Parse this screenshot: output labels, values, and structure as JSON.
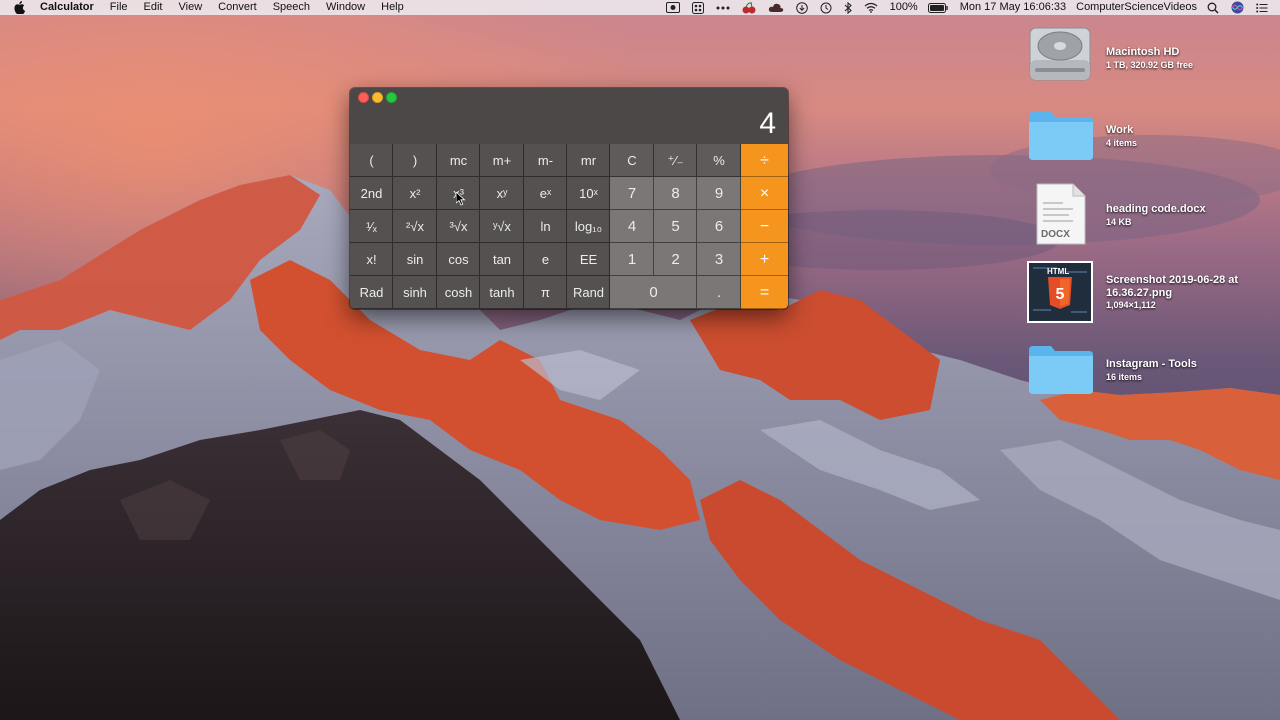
{
  "menubar": {
    "app_name": "Calculator",
    "menus": [
      "File",
      "Edit",
      "View",
      "Convert",
      "Speech",
      "Window",
      "Help"
    ],
    "battery": "100%",
    "datetime": "Mon 17 May  16:06:33",
    "user": "ComputerScienceVideos"
  },
  "calculator": {
    "display": "4",
    "keys": [
      {
        "label": "(",
        "kind": "sci"
      },
      {
        "label": ")",
        "kind": "sci"
      },
      {
        "label": "mc",
        "kind": "sci"
      },
      {
        "label": "m+",
        "kind": "sci"
      },
      {
        "label": "m-",
        "kind": "sci"
      },
      {
        "label": "mr",
        "kind": "sci"
      },
      {
        "label": "C",
        "kind": "top"
      },
      {
        "label": "⁺∕₋",
        "kind": "top"
      },
      {
        "label": "%",
        "kind": "top"
      },
      {
        "label": "÷",
        "kind": "op"
      },
      {
        "label": "2nd",
        "kind": "sci"
      },
      {
        "label": "x²",
        "kind": "sci"
      },
      {
        "label": "x³",
        "kind": "sci"
      },
      {
        "label": "xʸ",
        "kind": "sci"
      },
      {
        "label": "eˣ",
        "kind": "sci"
      },
      {
        "label": "10ˣ",
        "kind": "sci"
      },
      {
        "label": "7",
        "kind": "num"
      },
      {
        "label": "8",
        "kind": "num"
      },
      {
        "label": "9",
        "kind": "num"
      },
      {
        "label": "×",
        "kind": "op"
      },
      {
        "label": "¹∕ₓ",
        "kind": "sci"
      },
      {
        "label": "²√x",
        "kind": "sci"
      },
      {
        "label": "³√x",
        "kind": "sci"
      },
      {
        "label": "ʸ√x",
        "kind": "sci"
      },
      {
        "label": "ln",
        "kind": "sci"
      },
      {
        "label": "log₁₀",
        "kind": "sci"
      },
      {
        "label": "4",
        "kind": "num"
      },
      {
        "label": "5",
        "kind": "num"
      },
      {
        "label": "6",
        "kind": "num"
      },
      {
        "label": "−",
        "kind": "op"
      },
      {
        "label": "x!",
        "kind": "sci"
      },
      {
        "label": "sin",
        "kind": "sci"
      },
      {
        "label": "cos",
        "kind": "sci"
      },
      {
        "label": "tan",
        "kind": "sci"
      },
      {
        "label": "e",
        "kind": "sci"
      },
      {
        "label": "EE",
        "kind": "sci"
      },
      {
        "label": "1",
        "kind": "num"
      },
      {
        "label": "2",
        "kind": "num"
      },
      {
        "label": "3",
        "kind": "num"
      },
      {
        "label": "+",
        "kind": "op"
      },
      {
        "label": "Rad",
        "kind": "sci"
      },
      {
        "label": "sinh",
        "kind": "sci"
      },
      {
        "label": "cosh",
        "kind": "sci"
      },
      {
        "label": "tanh",
        "kind": "sci"
      },
      {
        "label": "π",
        "kind": "sci"
      },
      {
        "label": "Rand",
        "kind": "sci"
      },
      {
        "label": "0",
        "kind": "num zero"
      },
      {
        "label": ".",
        "kind": "num"
      },
      {
        "label": "=",
        "kind": "op"
      }
    ]
  },
  "desktop": {
    "items": [
      {
        "name": "Macintosh HD",
        "info": "1 TB, 320.92 GB free",
        "icon": "hard-drive-icon"
      },
      {
        "name": "Work",
        "info": "4 items",
        "icon": "folder-icon"
      },
      {
        "name": "heading code.docx",
        "info": "14 KB",
        "icon": "docx-file-icon",
        "badge": "DOCX"
      },
      {
        "name": "Screenshot 2019-06-28 at",
        "name2": "16.36.27.png",
        "info": "1,094×1,112",
        "icon": "screenshot-thumbnail-icon",
        "badge": "HTML"
      },
      {
        "name": "Instagram - Tools",
        "info": "16 items",
        "icon": "folder-icon"
      }
    ]
  }
}
